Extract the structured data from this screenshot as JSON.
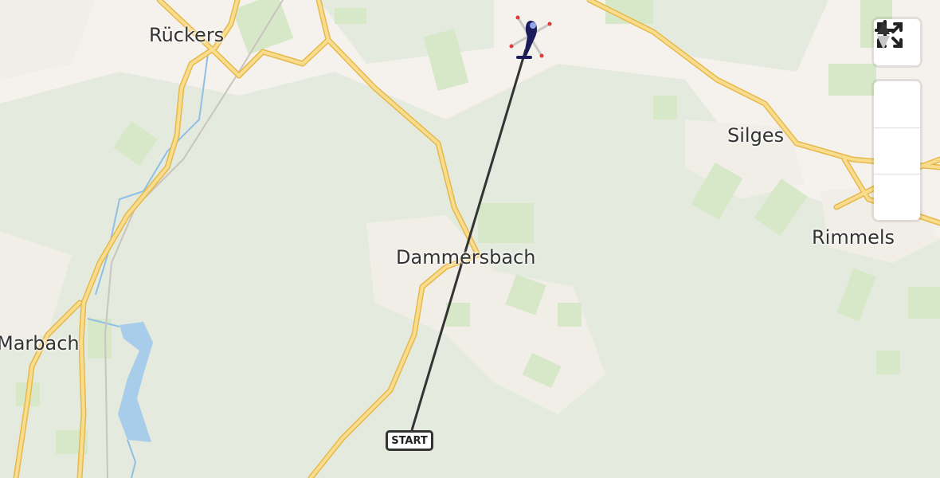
{
  "map": {
    "places": [
      {
        "name": "Rückers"
      },
      {
        "name": "Silges"
      },
      {
        "name": "Dammersbach"
      },
      {
        "name": "Rimmels"
      },
      {
        "name": "Marbach"
      }
    ],
    "route": {
      "start_label": "START",
      "color": "#333333"
    },
    "colors": {
      "land": "#f5f1ec",
      "forest": "#e4eade",
      "field": "#d6e8c8",
      "road": "#f6cf6e",
      "water": "#a8cdea"
    }
  },
  "controls": {
    "fullscreen": {
      "icon": "fullscreen-icon"
    },
    "zoom_in": {
      "icon": "plus-icon"
    },
    "zoom_out": {
      "icon": "minus-icon"
    },
    "compass": {
      "icon": "compass-north-icon"
    }
  },
  "marker": {
    "icon": "helicopter-icon"
  }
}
